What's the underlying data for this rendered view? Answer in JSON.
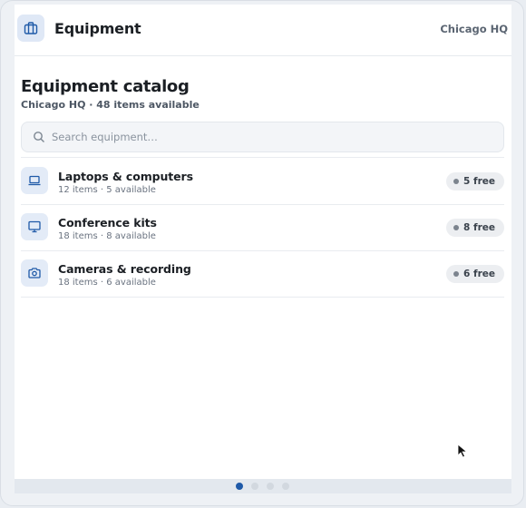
{
  "header": {
    "app_icon": "briefcase-icon",
    "title": "Equipment",
    "location": "Chicago HQ"
  },
  "main": {
    "title": "Equipment catalog",
    "subtitle": "Chicago HQ · 48 items available"
  },
  "search": {
    "placeholder": "Search equipment…",
    "value": ""
  },
  "categories": [
    {
      "icon": "laptop-icon",
      "name": "Laptops & computers",
      "detail": "12 items · 5 available",
      "badge": "5 free"
    },
    {
      "icon": "monitor-icon",
      "name": "Conference kits",
      "detail": "18 items · 8 available",
      "badge": "8 free"
    },
    {
      "icon": "camera-icon",
      "name": "Cameras & recording",
      "detail": "18 items · 6 available",
      "badge": "6 free"
    }
  ],
  "pager": {
    "pages": 4,
    "current": 1
  },
  "colors": {
    "accent": "#1f5aa8",
    "icon_bg": "#e3ebf7",
    "badge_bg": "#eceef1"
  }
}
